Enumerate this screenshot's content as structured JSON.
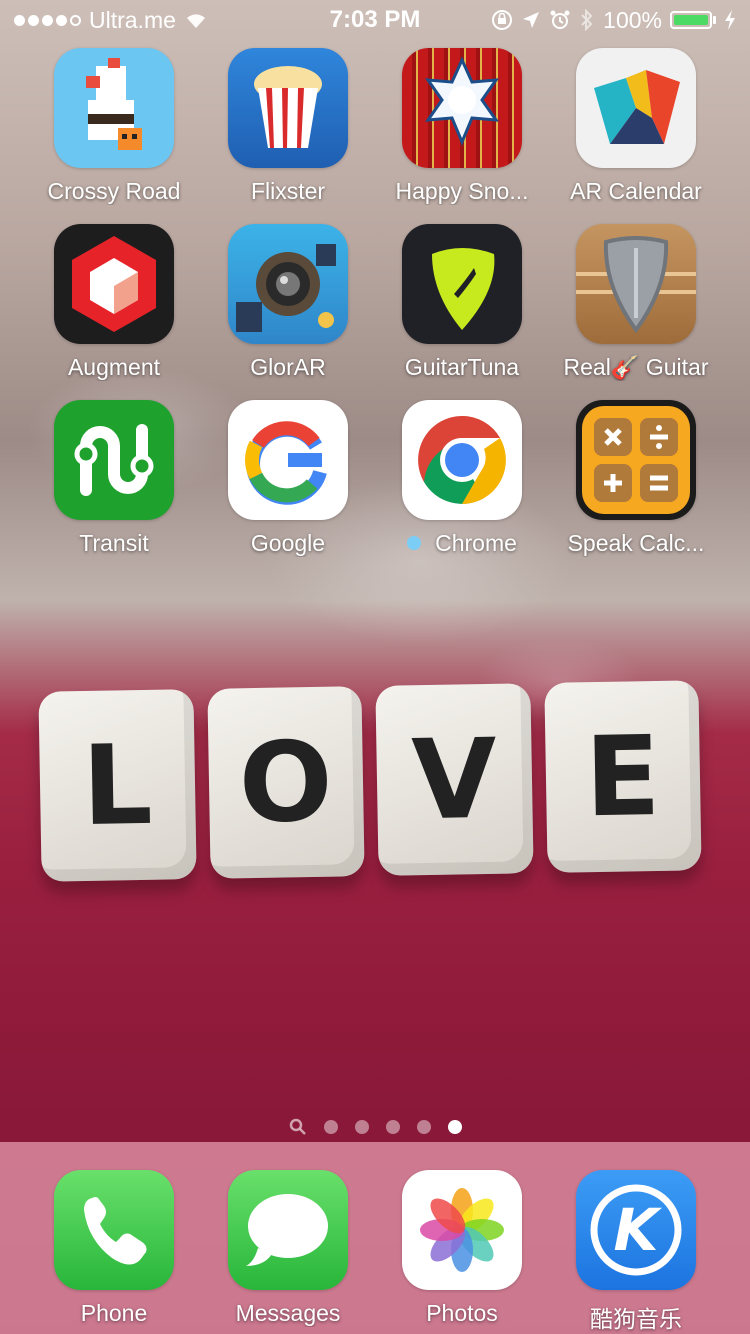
{
  "status_bar": {
    "carrier": "Ultra.me",
    "time": "7:03 PM",
    "battery": "100%",
    "signal_bars": 4,
    "signal_total": 5,
    "icons": [
      "wifi-icon",
      "rotation-lock-icon",
      "location-icon",
      "alarm-icon",
      "bluetooth-icon",
      "charging-icon"
    ]
  },
  "apps": [
    {
      "label": "Crossy Road",
      "icon": "crossy-road-icon",
      "bg": "#6cc6f2"
    },
    {
      "label": "Flixster",
      "icon": "flixster-icon",
      "bg": "#2a7bd1"
    },
    {
      "label": "Happy Sno...",
      "icon": "happy-snow-icon",
      "bg": "#c61b1b"
    },
    {
      "label": "AR Calendar",
      "icon": "ar-calendar-icon",
      "bg": "#f1f1f1"
    },
    {
      "label": "Augment",
      "icon": "augment-icon",
      "bg": "#1d1d1d"
    },
    {
      "label": "GlorAR",
      "icon": "glorar-icon",
      "bg": "#38a8e2"
    },
    {
      "label": "GuitarTuna",
      "icon": "guitartuna-icon",
      "bg": "#1f2126"
    },
    {
      "label": "Real🎸 Guitar",
      "icon": "real-guitar-icon",
      "bg": "#b7864b"
    },
    {
      "label": "Transit",
      "icon": "transit-icon",
      "bg": "#1fa12d"
    },
    {
      "label": "Google",
      "icon": "google-icon",
      "bg": "#ffffff"
    },
    {
      "label": "Chrome",
      "icon": "chrome-icon",
      "bg": "#ffffff",
      "new": true
    },
    {
      "label": "Speak Calc...",
      "icon": "speak-calc-icon",
      "bg": "#f4a21c"
    }
  ],
  "wallpaper_text": [
    "L",
    "O",
    "V",
    "E"
  ],
  "page_dots": {
    "count": 5,
    "active": 5,
    "search": true
  },
  "dock": [
    {
      "label": "Phone",
      "icon": "phone-icon",
      "bg": "#3fcd4c"
    },
    {
      "label": "Messages",
      "icon": "messages-icon",
      "bg": "#3fcd4c"
    },
    {
      "label": "Photos",
      "icon": "photos-icon",
      "bg": "#ffffff"
    },
    {
      "label": "酷狗音乐",
      "icon": "kugou-icon",
      "bg": "#2a8cf0"
    }
  ]
}
